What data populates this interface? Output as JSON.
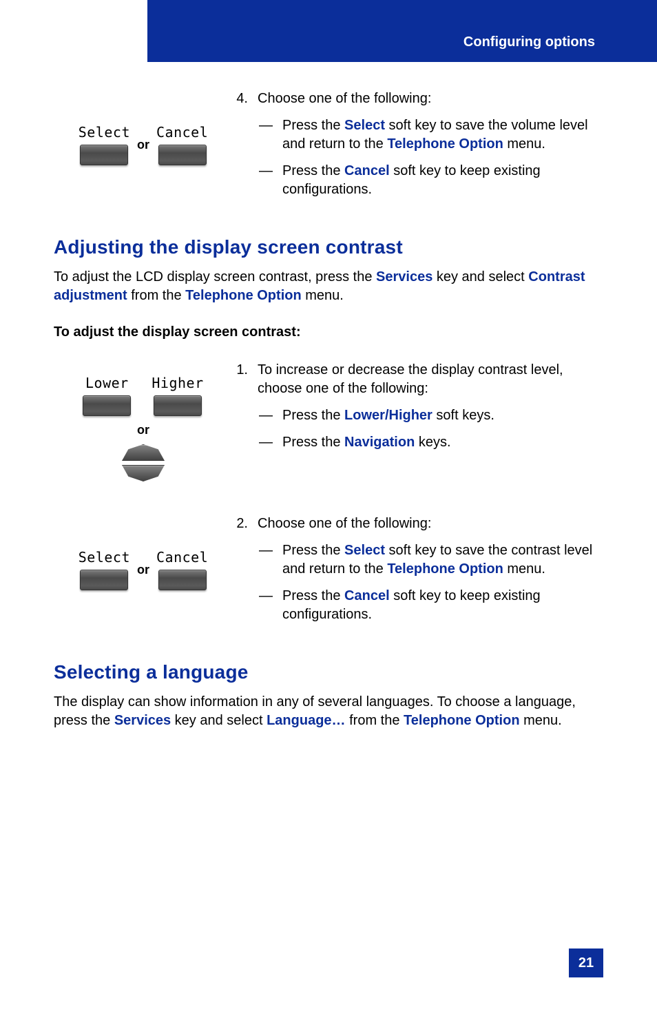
{
  "header": {
    "chapter": "Configuring options"
  },
  "page_number": "21",
  "step4": {
    "num": "4.",
    "lead": "Choose one of the following:",
    "softkeys": {
      "left": "Select",
      "right": "Cancel",
      "or": "or"
    },
    "items": [
      {
        "pre": "Press the ",
        "k1": "Select",
        "mid": " soft key to save the volume level and return to the ",
        "k2": "Telephone Option",
        "post": " menu."
      },
      {
        "pre": "Press the ",
        "k1": "Cancel",
        "mid": " soft key to keep existing configurations.",
        "k2": "",
        "post": ""
      }
    ]
  },
  "section_contrast": {
    "heading": "Adjusting the display screen contrast",
    "intro": {
      "pre": "To adjust the LCD display screen contrast, press the ",
      "k1": "Services",
      "mid": " key and select ",
      "k2": "Contrast adjustment",
      "mid2": " from the ",
      "k3": "Telephone Option",
      "post": " menu."
    },
    "lead_bold": "To adjust the display screen contrast:",
    "step1": {
      "num": "1.",
      "lead": "To increase or decrease the display contrast level, choose one of the following:",
      "labels": {
        "lower": "Lower",
        "higher": "Higher",
        "or": "or"
      },
      "items": [
        {
          "pre": "Press the ",
          "k1": "Lower/Higher",
          "post": " soft keys."
        },
        {
          "pre": "Press the ",
          "k1": "Navigation",
          "post": " keys."
        }
      ]
    },
    "step2": {
      "num": "2.",
      "lead": "Choose one of the following:",
      "softkeys": {
        "left": "Select",
        "right": "Cancel",
        "or": "or"
      },
      "items": [
        {
          "pre": "Press the ",
          "k1": "Select",
          "mid": " soft key to save the contrast level and return to the ",
          "k2": "Telephone Option",
          "post": " menu."
        },
        {
          "pre": "Press the ",
          "k1": "Cancel",
          "mid": " soft key to keep existing configurations.",
          "k2": "",
          "post": ""
        }
      ]
    }
  },
  "section_lang": {
    "heading": "Selecting a language",
    "intro": {
      "pre": "The display can show information in any of several languages. To choose a language, press the ",
      "k1": "Services",
      "mid": " key and select ",
      "k2": "Language…",
      "mid2": " from the ",
      "k3": "Telephone Option",
      "post": " menu."
    }
  }
}
